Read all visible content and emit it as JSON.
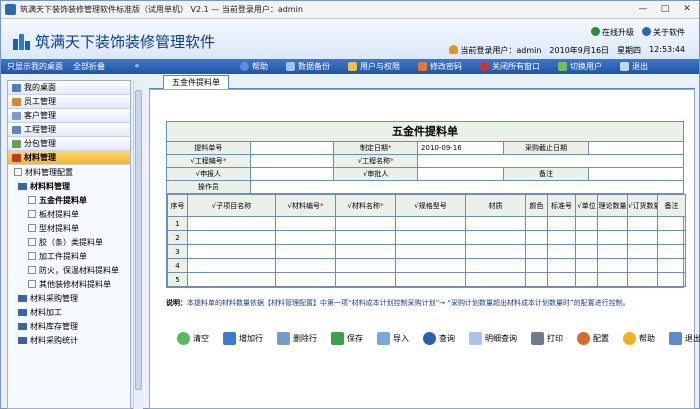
{
  "window": {
    "title": "筑满天下装饰装修管理软件标准版（试用单机） V2.1 — 当前登录用户：admin"
  },
  "header": {
    "app_title": "筑满天下装饰装修管理软件",
    "online_upgrade": "在线升级",
    "about": "关于软件",
    "current_user": "当前登录用户：admin",
    "date": "2010年9月16日",
    "weekday": "星期四",
    "time": "12:53:44"
  },
  "toolbar": {
    "show_desktop": "只显示我的桌面",
    "collapse_all": "全部折叠",
    "items": [
      "帮助",
      "数据备份",
      "用户与权限",
      "修改密码",
      "关闭所有窗口",
      "切换用户",
      "退出"
    ]
  },
  "sidebar": {
    "groups": [
      "我的桌面",
      "员工管理",
      "客户管理",
      "工程管理",
      "分包管理",
      "材料管理"
    ],
    "material": {
      "config": "材料管理配置",
      "section": "材料料管理",
      "items": [
        "五金件提料单",
        "板材提料单",
        "型材提料单",
        "胶（条）类提料单",
        "加工件提料单",
        "防火，保温材料提料单",
        "其他装修材料提料单"
      ],
      "folders": [
        "材料采购管理",
        "材料加工",
        "材料库存管理",
        "材料采购统计"
      ]
    }
  },
  "tab": {
    "label": "五金件提料单"
  },
  "form": {
    "title": "五金件提料单",
    "row1": {
      "l1": "提料单号",
      "l2": "制定日期",
      "date": "2010-09-16",
      "l3": "采购截止日期"
    },
    "row2": {
      "l1": "工程编号",
      "l2": "工程名称"
    },
    "row3": {
      "l1": "申报人",
      "l2": "审批人",
      "l3": "备注"
    },
    "row4": {
      "l1": "操作员"
    },
    "columns": [
      "序号",
      "子项目名称",
      "材料编号",
      "材料名称",
      "规格型号",
      "材质",
      "颜色",
      "标准号",
      "单位",
      "理论数量",
      "订货数量",
      "备注"
    ],
    "rows": [
      "1",
      "2",
      "3",
      "4",
      "5"
    ]
  },
  "note": {
    "label": "说明：",
    "text": "本提料单的材料数量依据【材料管理配置】中第一项“材料成本计划控制采购计划”→ “采购计划数量超出材料成本计划数量时”的配置进行控制。"
  },
  "actions": [
    "清空",
    "增加行",
    "删除行",
    "保存",
    "导入",
    "查询",
    "明细查询",
    "打印",
    "配置",
    "帮助",
    "退出"
  ]
}
